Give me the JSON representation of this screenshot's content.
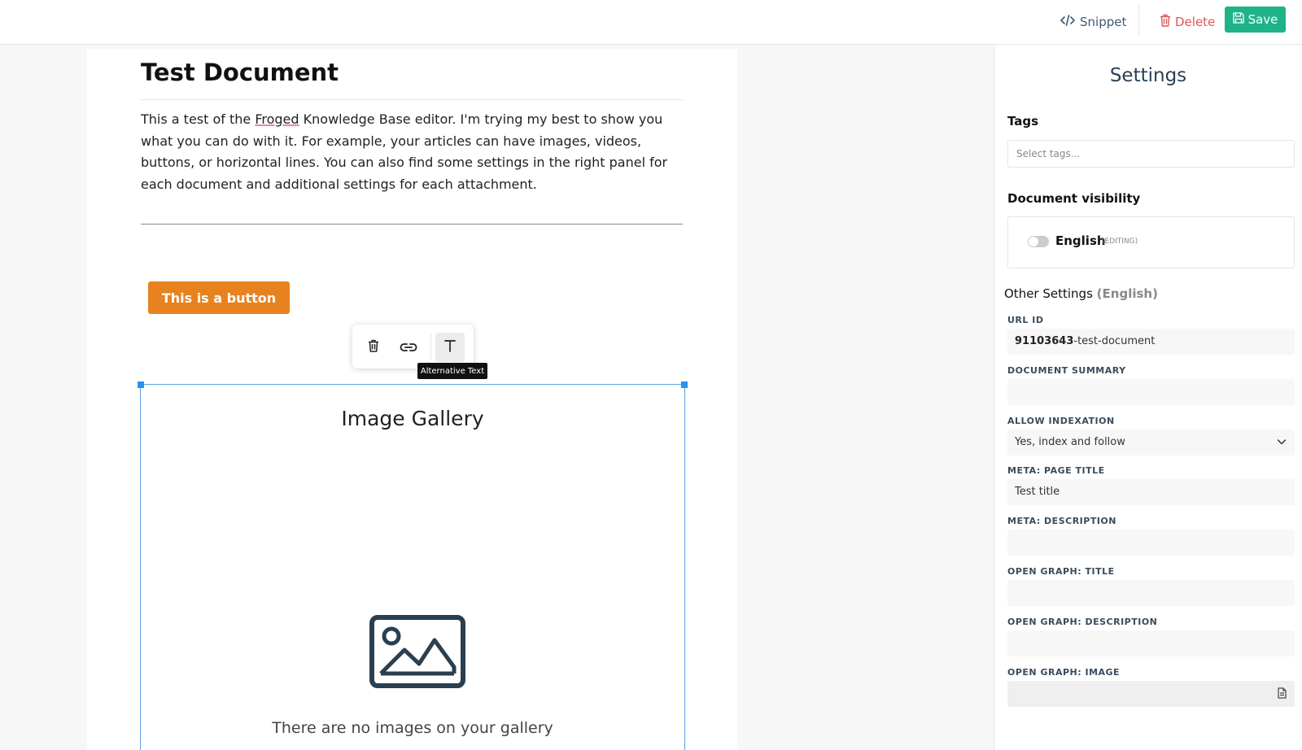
{
  "topbar": {
    "snippet_label": "Snippet",
    "delete_label": "Delete",
    "save_label": "Save"
  },
  "editor": {
    "title": "Test Document",
    "body_before": "This a test of the ",
    "body_underlined": "Froged",
    "body_after": " Knowledge Base editor. I'm trying my best to show you what you can do with it. For example, your articles can have images, videos, buttons, or horizontal lines. You can also find some settings in the right panel for each document and additional settings for each attachment.",
    "button_label": "This is a button",
    "toolbar_tooltip": "Alternative Text",
    "gallery": {
      "title": "Image Gallery",
      "empty_text": "There are no images on your gallery"
    }
  },
  "settings": {
    "title": "Settings",
    "tags_label": "Tags",
    "tags_placeholder": "Select tags...",
    "visibility_label": "Document visibility",
    "language": "English",
    "language_status": "(EDITING)",
    "other_settings_label": "Other Settings",
    "other_settings_lang": "(English)",
    "fields": {
      "url_id": {
        "label": "URL ID",
        "value_bold": "91103643",
        "value_rest": "-test-document"
      },
      "summary": {
        "label": "DOCUMENT SUMMARY",
        "value": ""
      },
      "indexation": {
        "label": "ALLOW INDEXATION",
        "value": "Yes, index and follow"
      },
      "meta_title": {
        "label": "META: PAGE TITLE",
        "value": "Test title"
      },
      "meta_description": {
        "label": "META: DESCRIPTION",
        "value": ""
      },
      "og_title": {
        "label": "OPEN GRAPH: TITLE",
        "value": ""
      },
      "og_description": {
        "label": "OPEN GRAPH: DESCRIPTION",
        "value": ""
      },
      "og_image": {
        "label": "OPEN GRAPH: IMAGE",
        "value": ""
      }
    }
  },
  "colors": {
    "save": "#1fb38a",
    "delete": "#e05555",
    "cta": "#e8821f",
    "selection": "#2d8ff0"
  },
  "icons": [
    "code-icon",
    "trash-icon",
    "save-icon",
    "link-icon",
    "text-icon",
    "image-icon",
    "chevron-down-icon",
    "file-icon"
  ]
}
